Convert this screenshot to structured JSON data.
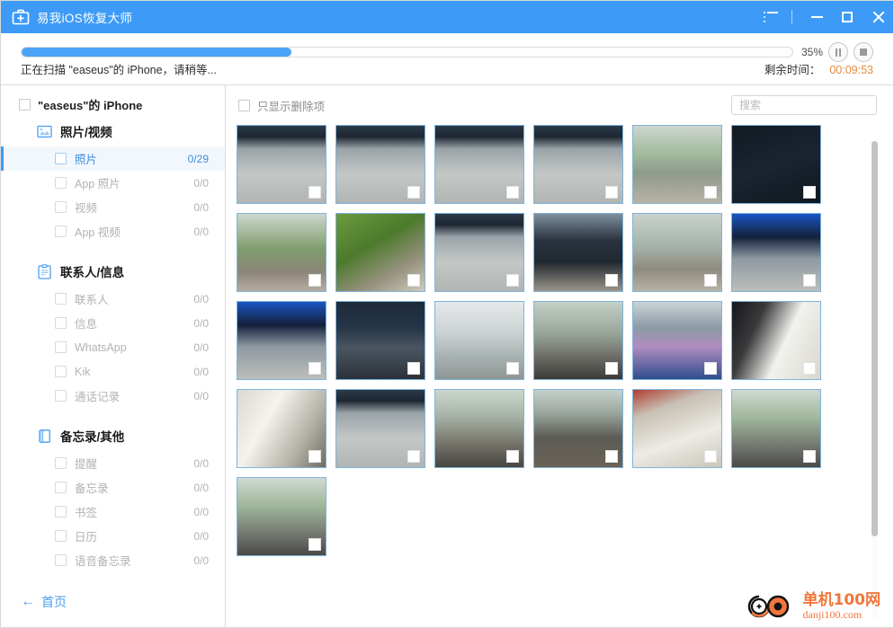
{
  "window": {
    "title": "易我iOS恢复大师",
    "app_icon": "first-aid-kit-icon",
    "controls": {
      "menu": "menu-icon",
      "minimize": "minimize-icon",
      "maximize": "maximize-icon",
      "close": "close-icon"
    }
  },
  "progress": {
    "percent_label": "35%",
    "percent_value": 35,
    "status_text": "正在扫描 \"easeus\"的 iPhone，请稍等...",
    "remaining_label": "剩余时间：",
    "remaining_value": "00:09:53",
    "pause_icon": "pause-icon",
    "stop_icon": "stop-icon",
    "fill_color": "#4ba3f7"
  },
  "sidebar": {
    "root": {
      "label": "\"easeus\"的 iPhone",
      "checked": false
    },
    "groups": [
      {
        "label": "照片/视频",
        "icon": "photo-icon",
        "items": [
          {
            "label": "照片",
            "count": "0/29",
            "selected": true
          },
          {
            "label": "App 照片",
            "count": "0/0",
            "selected": false
          },
          {
            "label": "视频",
            "count": "0/0",
            "selected": false
          },
          {
            "label": "App 视频",
            "count": "0/0",
            "selected": false
          }
        ]
      },
      {
        "label": "联系人/信息",
        "icon": "contacts-icon",
        "items": [
          {
            "label": "联系人",
            "count": "0/0",
            "selected": false
          },
          {
            "label": "信息",
            "count": "0/0",
            "selected": false
          },
          {
            "label": "WhatsApp",
            "count": "0/0",
            "selected": false
          },
          {
            "label": "Kik",
            "count": "0/0",
            "selected": false
          },
          {
            "label": "通话记录",
            "count": "0/0",
            "selected": false
          }
        ]
      },
      {
        "label": "备忘录/其他",
        "icon": "notebook-icon",
        "items": [
          {
            "label": "提醒",
            "count": "0/0",
            "selected": false
          },
          {
            "label": "备忘录",
            "count": "0/0",
            "selected": false
          },
          {
            "label": "书签",
            "count": "0/0",
            "selected": false
          },
          {
            "label": "日历",
            "count": "0/0",
            "selected": false
          },
          {
            "label": "语音备忘录",
            "count": "0/0",
            "selected": false
          }
        ]
      }
    ],
    "home_link": {
      "label": "首页",
      "arrow": "←"
    }
  },
  "content": {
    "filter_checkbox_label": "只显示删除项",
    "filter_checked": false,
    "search": {
      "placeholder": "搜索",
      "value": ""
    },
    "thumbnails": [
      {
        "id": 1,
        "desc": "office-monitor-rig"
      },
      {
        "id": 2,
        "desc": "office-monitor-rig"
      },
      {
        "id": 3,
        "desc": "office-monitor-rig"
      },
      {
        "id": 4,
        "desc": "office-monitor-rig"
      },
      {
        "id": 5,
        "desc": "office-desk-people"
      },
      {
        "id": 6,
        "desc": "dark-frame"
      },
      {
        "id": 7,
        "desc": "office-desk-plant"
      },
      {
        "id": 8,
        "desc": "green-plant-desk"
      },
      {
        "id": 9,
        "desc": "office-monitor-rig"
      },
      {
        "id": 10,
        "desc": "desktop-computer-keyboard"
      },
      {
        "id": 11,
        "desc": "office-desk-wide"
      },
      {
        "id": 12,
        "desc": "blue-screen-monitor"
      },
      {
        "id": 13,
        "desc": "blue-screen-monitor"
      },
      {
        "id": 14,
        "desc": "monitor-keyboard-dark"
      },
      {
        "id": 15,
        "desc": "office-ceiling-lights"
      },
      {
        "id": 16,
        "desc": "office-chairs-desks"
      },
      {
        "id": 17,
        "desc": "office-tv-wall"
      },
      {
        "id": 18,
        "desc": "motion-blur-white"
      },
      {
        "id": 19,
        "desc": "motion-blur-bright"
      },
      {
        "id": 20,
        "desc": "office-monitor-rig"
      },
      {
        "id": 21,
        "desc": "person-at-desk"
      },
      {
        "id": 22,
        "desc": "person-standing-office"
      },
      {
        "id": 23,
        "desc": "paper-on-desk"
      },
      {
        "id": 24,
        "desc": "office-people-desks"
      },
      {
        "id": 25,
        "desc": "office-people-desks"
      }
    ]
  },
  "watermark": {
    "cn": "单机100网",
    "en": "danji100.com",
    "color": "#f0763a"
  }
}
